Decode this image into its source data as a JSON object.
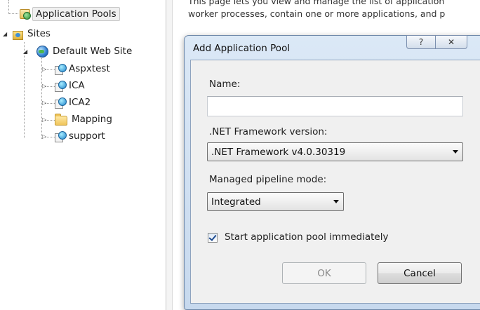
{
  "tree": {
    "application_pools": "Application Pools",
    "sites": "Sites",
    "default_web_site": "Default Web Site",
    "children": [
      "Aspxtest",
      "ICA",
      "ICA2",
      "Mapping",
      "support"
    ]
  },
  "main": {
    "line1": "This page lets you view and manage the list of application",
    "line2": "worker processes, contain one or more applications, and p"
  },
  "dialog": {
    "title": "Add Application Pool",
    "help_glyph": "?",
    "close_glyph": "✕",
    "name_label": "Name:",
    "name_value": "",
    "framework_label": ".NET Framework version:",
    "framework_value": ".NET Framework v4.0.30319",
    "pipeline_label": "Managed pipeline mode:",
    "pipeline_value": "Integrated",
    "start_label": "Start application pool immediately",
    "start_checked": true,
    "ok_label": "OK",
    "cancel_label": "Cancel"
  }
}
